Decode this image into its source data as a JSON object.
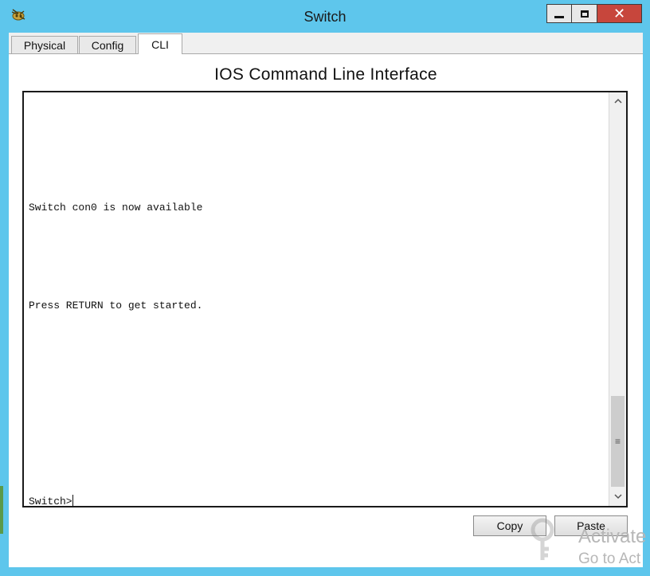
{
  "window": {
    "title": "Switch"
  },
  "tabs": [
    {
      "label": "Physical"
    },
    {
      "label": "Config"
    },
    {
      "label": "CLI"
    }
  ],
  "cli": {
    "heading": "IOS Command Line Interface",
    "lines": [
      "Switch con0 is now available",
      "Press RETURN to get started."
    ],
    "prompt": "Switch>"
  },
  "buttons": {
    "copy": "Copy",
    "paste": "Paste"
  },
  "watermark": {
    "line1": "Activate",
    "line2": "Go to Act"
  },
  "colors": {
    "titlebar": "#5ec6ec",
    "close_button": "#c7463c"
  },
  "icons": {
    "app": "packet-tracer-icon",
    "minimize": "minimize-icon",
    "maximize": "maximize-icon",
    "close": "close-icon",
    "scroll_up": "chevron-up-icon",
    "scroll_down": "chevron-down-icon",
    "watermark": "key-icon"
  }
}
